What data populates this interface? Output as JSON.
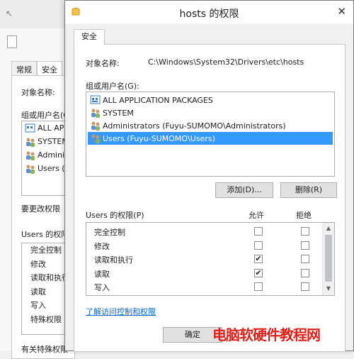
{
  "background_window": {
    "tabs": [
      {
        "label": "常规"
      },
      {
        "label": "安全"
      }
    ],
    "object_name_label": "对象名称:",
    "group_label": "组或用户名(G",
    "users": [
      {
        "label": "ALL AP"
      },
      {
        "label": "SYSTEM"
      },
      {
        "label": "Admini"
      },
      {
        "label": "Users ("
      }
    ],
    "change_perm_label": "要更改权限",
    "users_perm_label": "Users 的权限",
    "perms": [
      {
        "label": "完全控制"
      },
      {
        "label": "修改"
      },
      {
        "label": "读取和执行"
      },
      {
        "label": "读取"
      },
      {
        "label": "写入"
      },
      {
        "label": "特殊权限"
      }
    ],
    "advanced_label": "有关特殊权限"
  },
  "dialog": {
    "title": "hosts 的权限",
    "tab": "安全",
    "object_name_label": "对象名称:",
    "object_name_value": "C:\\Windows\\System32\\Drivers\\etc\\hosts",
    "group_label": "组或用户名(G):",
    "users": [
      {
        "label": "ALL APPLICATION PACKAGES",
        "icon": "app-packages-icon"
      },
      {
        "label": "SYSTEM",
        "icon": "user-group-icon"
      },
      {
        "label": "Administrators (Fuyu-SUMOMO\\Administrators)",
        "icon": "user-group-icon"
      },
      {
        "label": "Users (Fuyu-SUMOMO\\Users)",
        "icon": "user-group-icon",
        "selected": true
      }
    ],
    "add_button": "添加(D)...",
    "remove_button": "删除(R)",
    "perm_header": "Users 的权限(P)",
    "allow_header": "允许",
    "deny_header": "拒绝",
    "permissions": [
      {
        "name": "完全控制",
        "allow": false,
        "deny": false
      },
      {
        "name": "修改",
        "allow": false,
        "deny": false
      },
      {
        "name": "读取和执行",
        "allow": true,
        "deny": false
      },
      {
        "name": "读取",
        "allow": true,
        "deny": false
      },
      {
        "name": "写入",
        "allow": false,
        "deny": false
      }
    ],
    "link": "了解访问控制和权限",
    "ok_button": "确定"
  },
  "watermark": "电脑软硬件教程网",
  "colors": {
    "selection": "#3399ff",
    "link": "#0066cc",
    "watermark": "#e0201a"
  }
}
